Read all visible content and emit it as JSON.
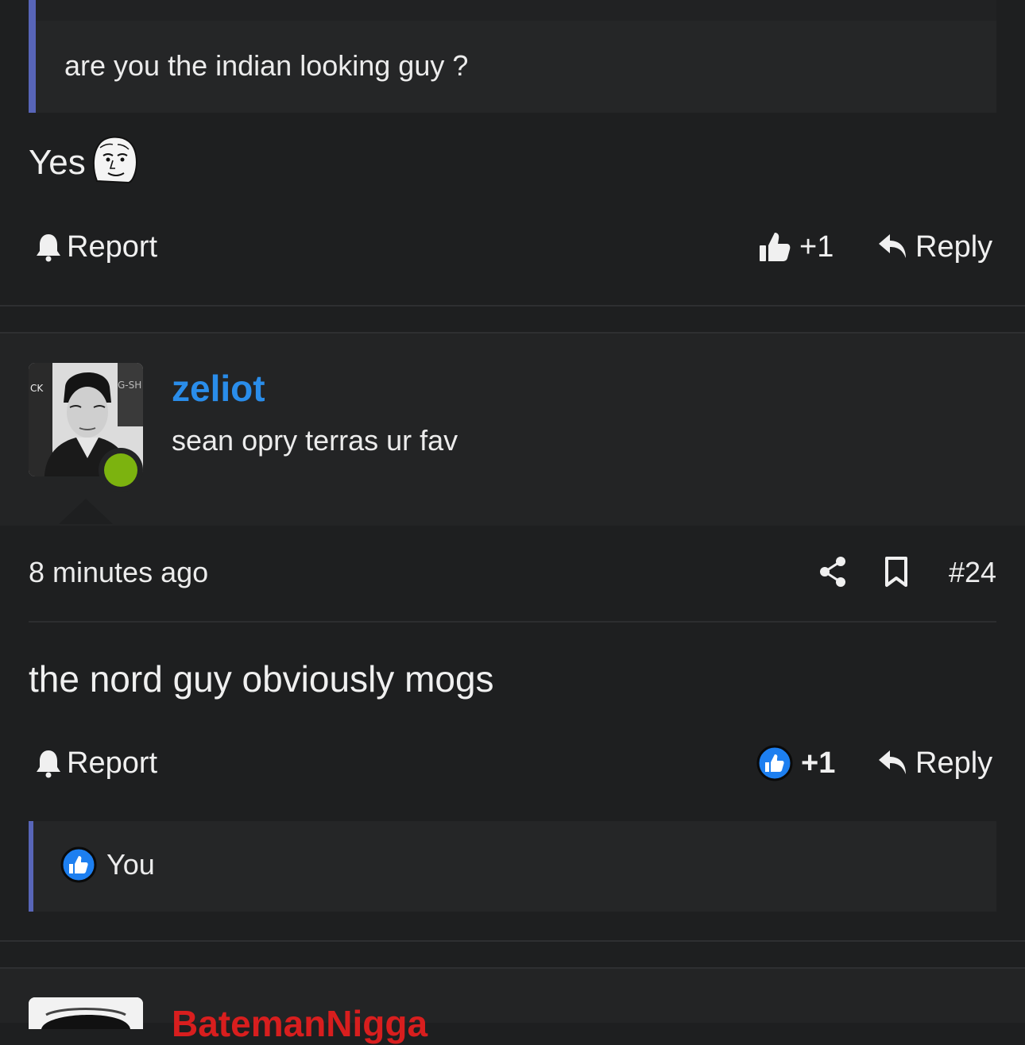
{
  "quoted_post": {
    "text": "are you the indian looking guy ?"
  },
  "reply_post": {
    "text": "Yes",
    "emoji": "wojak-face",
    "report_label": "Report",
    "like_count": "+1",
    "reply_label": "Reply"
  },
  "post": {
    "username": "zeliot",
    "user_title": "sean opry terras ur fav",
    "timestamp": "8 minutes ago",
    "number": "#24",
    "body": "the nord guy obviously mogs",
    "report_label": "Report",
    "like_count": "+1",
    "reply_label": "Reply",
    "reactions": {
      "user": "You"
    }
  },
  "next_post": {
    "username": "BatemanNigga"
  },
  "colors": {
    "background": "#1e1f20",
    "accent_border": "#5865b8",
    "username_blue": "#2a8dea",
    "username_red": "#d81e1e",
    "online_green": "#7cb30f",
    "like_blue": "#1d7ff0"
  }
}
